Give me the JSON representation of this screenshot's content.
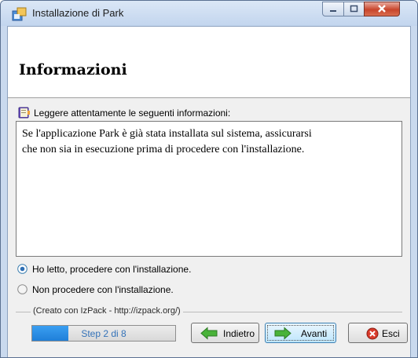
{
  "window": {
    "title": "Installazione di  Park",
    "controls": [
      "minimize-icon",
      "maximize-icon",
      "close-icon"
    ]
  },
  "header": {
    "title": "Informazioni"
  },
  "info": {
    "label": "Leggere attentamente le seguenti informazioni:",
    "lines": [
      "Se l'applicazione Park è già stata installata sul sistema, assicurarsi",
      "che non sia in esecuzione prima di procedere con l'installazione."
    ]
  },
  "options": [
    {
      "label": "Ho letto, procedere con l'installazione.",
      "selected": true
    },
    {
      "label": "Non procedere con l'installazione.",
      "selected": false
    }
  ],
  "footer": {
    "credit": "(Creato con IzPack - http://izpack.org/)",
    "progress_text": "Step 2 di 8",
    "progress_fraction": 0.25
  },
  "buttons": {
    "back": "Indietro",
    "next": "Avanti",
    "quit": "Esci"
  },
  "colors": {
    "accent": "#1f7fd8",
    "close": "#c8452b"
  }
}
